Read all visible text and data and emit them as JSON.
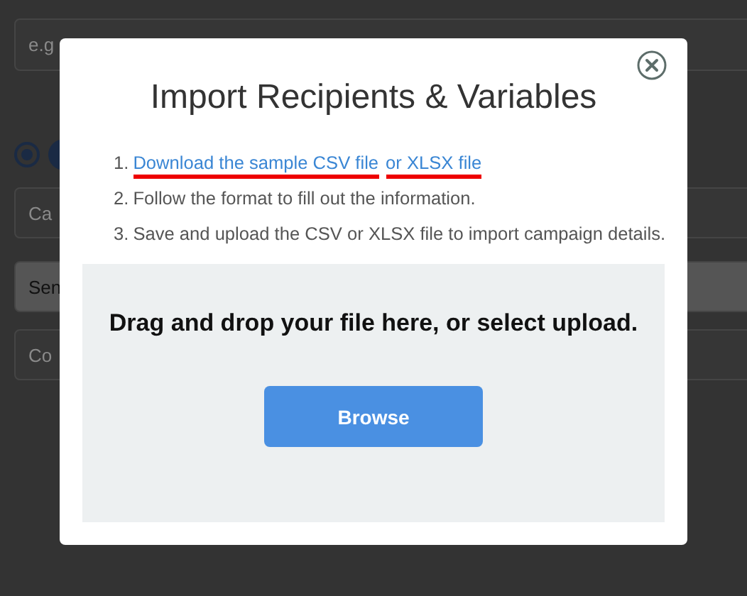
{
  "background": {
    "fields": [
      {
        "text": "e.g",
        "kind": "input"
      },
      {
        "text": "Ca",
        "kind": "input"
      },
      {
        "text": "Sen",
        "kind": "select"
      },
      {
        "text": "Co",
        "kind": "input"
      }
    ],
    "radio": {
      "selected": true
    }
  },
  "modal": {
    "title": "Import Recipients & Variables",
    "steps": [
      {
        "number": "1.",
        "parts": [
          {
            "text": "Download the sample CSV file",
            "kind": "link",
            "underlined": true
          },
          {
            "text": "or XLSX file",
            "kind": "link",
            "underlined": true
          }
        ]
      },
      {
        "number": "2.",
        "parts": [
          {
            "text": "Follow the format to fill out the information.",
            "kind": "text"
          }
        ]
      },
      {
        "number": "3.",
        "parts": [
          {
            "text": "Save and upload the CSV or XLSX file to import campaign details.",
            "kind": "text"
          }
        ]
      }
    ],
    "dropzone": {
      "text": "Drag and drop your file here, or select upload.",
      "button": "Browse"
    }
  }
}
